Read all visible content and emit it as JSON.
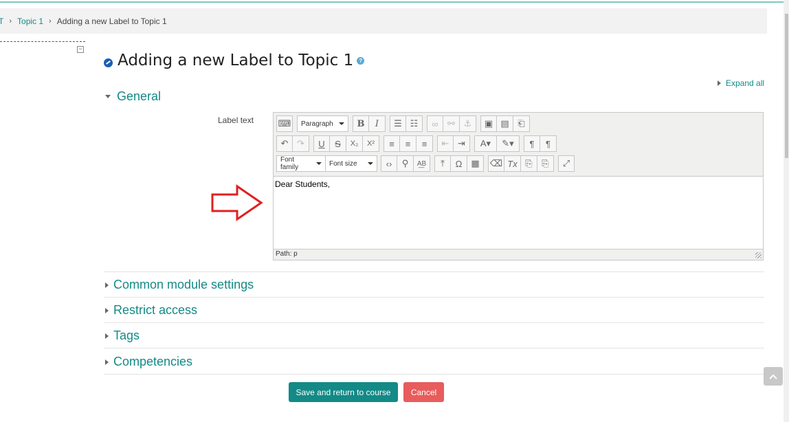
{
  "breadcrumb": {
    "cut_item": "T",
    "topic": "Topic 1",
    "current": "Adding a new Label to Topic 1"
  },
  "page": {
    "title": "Adding a new Label to Topic 1"
  },
  "expand_all": "Expand all",
  "sections": {
    "general": "General",
    "common": "Common module settings",
    "restrict": "Restrict access",
    "tags": "Tags",
    "competencies": "Competencies"
  },
  "form": {
    "label_text": "Label text"
  },
  "editor": {
    "paragraph": "Paragraph",
    "font_family": "Font family",
    "font_size": "Font size",
    "content": "Dear Students,",
    "path": "Path: p"
  },
  "buttons": {
    "save": "Save and return to course",
    "cancel": "Cancel"
  },
  "colors": {
    "accent": "#138a87",
    "cancel": "#e85c5c",
    "arrow": "#e02020"
  }
}
